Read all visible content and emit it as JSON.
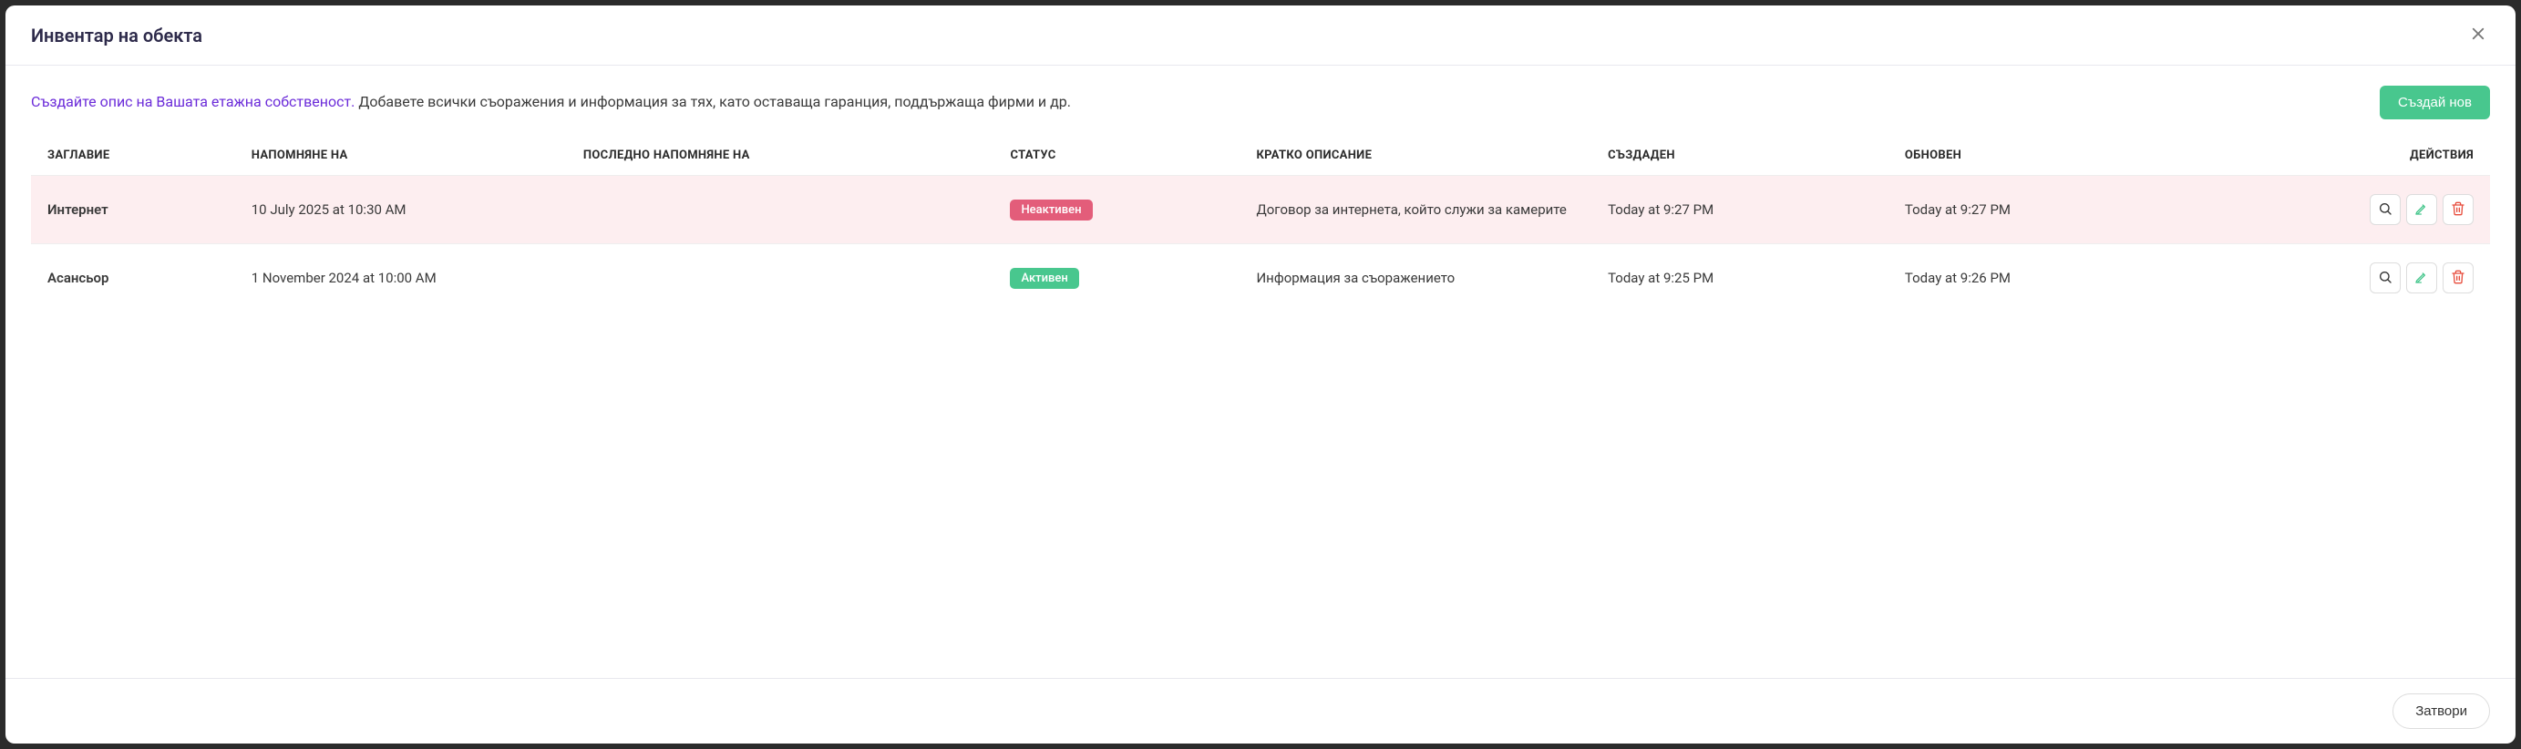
{
  "header": {
    "title": "Инвентар на обекта"
  },
  "description": {
    "link_text": "Създайте опис на Вашата етажна собственост.",
    "rest_text": " Добавете всички съоражения и информация за тях, като оставаща гаранция, поддържаща фирми и др."
  },
  "buttons": {
    "create_new": "Създай нов",
    "close_footer": "Затвори"
  },
  "table": {
    "headers": {
      "title": "ЗАГЛАВИЕ",
      "reminder": "НАПОМНЯНЕ НА",
      "last_reminder": "ПОСЛЕДНО НАПОМНЯНЕ НА",
      "status": "СТАТУС",
      "short_desc": "КРАТКО ОПИСАНИЕ",
      "created": "СЪЗДАДЕН",
      "updated": "ОБНОВЕН",
      "actions": "ДЕЙСТВИЯ"
    },
    "rows": [
      {
        "title": "Интернет",
        "reminder": "10 July 2025 at 10:30 AM",
        "last_reminder": "",
        "status_label": "Неактивен",
        "status": "inactive",
        "desc": "Договор за интернета, който служи за камерите",
        "created": "Today at 9:27 PM",
        "updated": "Today at 9:27 PM"
      },
      {
        "title": "Асансьор",
        "reminder": "1 November 2024 at 10:00 AM",
        "last_reminder": "",
        "status_label": "Активен",
        "status": "active",
        "desc": "Информация за съоражението",
        "created": "Today at 9:25 PM",
        "updated": "Today at 9:26 PM"
      }
    ]
  }
}
